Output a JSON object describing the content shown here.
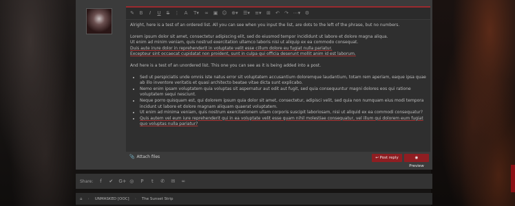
{
  "editor": {
    "paragraph_1": "Alright, here is a test of an ordered list. All you can see when you input the list, are dots to the left of the phrase, but no numbers.",
    "lorem_lines": [
      "Lorem ipsum dolor sit amet, consectetur adipiscing elit, sed do eiusmod tempor incididunt ut labore et dolore magna aliqua.",
      "Ut enim ad minim veniam, quis nostrud exercitation ullamco laboris nisi ut aliquip ex ea commodo consequat.",
      "Duis aute irure dolor in reprehenderit in voluptate velit esse cillum dolore eu fugiat nulla pariatur.",
      "Excepteur sint occaecat cupidatat non proident, sunt in culpa qui officia deserunt mollit anim id est laborum."
    ],
    "paragraph_2": "And here is a test of an unordered list. This one you can see as it is being added into a post.",
    "bullets": [
      "Sed ut perspiciatis unde omnis iste natus error sit voluptatem accusantium doloremque laudantium, totam rem aperiam, eaque ipsa quae ab illo inventore veritatis et quasi architecto beatae vitae dicta sunt explicabo.",
      "Nemo enim ipsam voluptatem quia voluptas sit aspernatur aut odit aut fugit, sed quia consequuntur magni dolores eos qui ratione voluptatem sequi nesciunt.",
      "Neque porro quisquam est, qui dolorem ipsum quia dolor sit amet, consectetur, adipisci velit, sed quia non numquam eius modi tempora incidunt ut labore et dolore magnam aliquam quaerat voluptatem.",
      "Ut enim ad minima veniam, quis nostrum exercitationem ullam corporis suscipit laboriosam, nisi ut aliquid ex ea commodi consequatur?",
      "Quis autem vel eum iure reprehenderit qui in ea voluptate velit esse quam nihil molestiae consequatur, vel illum qui dolorem eum fugiat quo voluptas nulla pariatur?"
    ]
  },
  "toolbar_icons": [
    "eraser-icon",
    "bold-icon",
    "italic-icon",
    "underline-icon",
    "strikethrough-icon",
    "more-text-icon",
    "font-size-icon",
    "text-color-icon",
    "link-icon",
    "image-icon",
    "smilie-icon",
    "insert-icon",
    "list-icon",
    "align-icon",
    "table-icon",
    "undo-icon",
    "redo-icon",
    "more-icon",
    "settings-icon"
  ],
  "actions": {
    "attach_label": "Attach files",
    "post_reply_label": "Post reply",
    "preview_label": "Preview"
  },
  "share": {
    "label": "Share:",
    "icons": [
      "facebook-icon",
      "twitter-icon",
      "google-plus-icon",
      "reddit-icon",
      "pinterest-icon",
      "tumblr-icon",
      "whatsapp-icon",
      "email-icon",
      "link-icon"
    ]
  },
  "breadcrumb": {
    "items": [
      "UNMASKED [OOC]",
      "The Sunset Strip"
    ]
  },
  "colors": {
    "accent": "#8f1e22",
    "panel": "#3b3b3b",
    "editor_bg": "#2f2f2f"
  }
}
